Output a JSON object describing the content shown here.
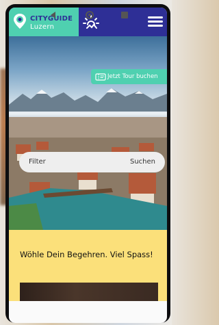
{
  "header": {
    "brand_top": "CITYGUIDE",
    "brand_bottom": "Luzern",
    "logo_icon": "map-pin-icon",
    "weather_icon": "sun-icon",
    "menu_icon": "hamburger-menu-icon"
  },
  "hero": {
    "tour_button_label": "Jetzt Tour buchen",
    "tour_button_icon": "ticket-icon",
    "search": {
      "placeholder": "Filter",
      "button_label": "Suchen"
    }
  },
  "content": {
    "headline": "Wöhle Dein Begehren. Viel Spass!"
  },
  "navbar": {
    "back_icon": "back-triangle-icon",
    "home_icon": "home-circle-icon",
    "recents_icon": "recents-square-icon"
  },
  "colors": {
    "teal": "#4fd0b0",
    "navy": "#2e2f96",
    "yellow": "#fbe07a"
  }
}
